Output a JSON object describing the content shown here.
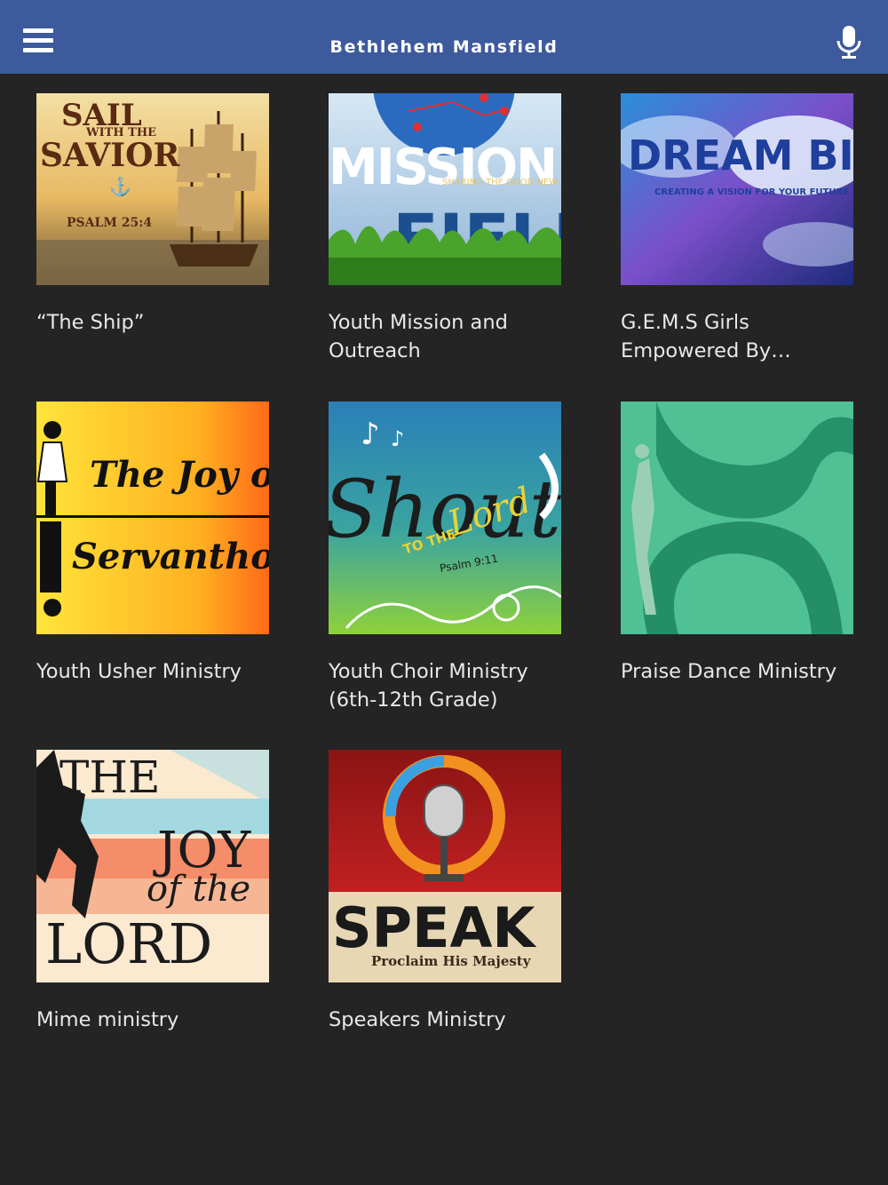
{
  "header": {
    "title": "Bethlehem Mansfield",
    "bg_color": "#3d5a9c",
    "menu_icon": "hamburger-menu-icon",
    "mic_icon": "microphone-icon"
  },
  "ministries": [
    {
      "label": "“The Ship”",
      "artwork": {
        "line1": "SAIL",
        "line2": "WITH THE",
        "line3": "SAVIOR",
        "line4": "PSALM 25:4"
      }
    },
    {
      "label": "Youth Mission and Outreach",
      "artwork": {
        "line1": "MISSION",
        "line2": "FIELD",
        "line3": "SHARING THE GOOD NEW"
      }
    },
    {
      "label": "G.E.M.S Girls Empowered By Ministry",
      "artwork": {
        "line1": "DREAM BIG",
        "line2": "CREATING A VISION FOR YOUR FUTURE"
      }
    },
    {
      "label": "Youth Usher Ministry",
      "artwork": {
        "line1": "The Joy of",
        "line2": "Servanthood"
      }
    },
    {
      "label": "Youth Choir Ministry (6th-12th Grade)",
      "artwork": {
        "line1": "Shout",
        "line2": "TO THE",
        "line3": "Lord",
        "line4": "Psalm 9:11"
      }
    },
    {
      "label": "Praise Dance Ministry",
      "artwork": {}
    },
    {
      "label": "Mime ministry",
      "artwork": {
        "line1": "THE",
        "line2": "JOY",
        "line3": "of the",
        "line4": "LORD"
      }
    },
    {
      "label": "Speakers Ministry",
      "artwork": {
        "line1": "SPEAK",
        "line2": "Proclaim His Majesty"
      }
    }
  ]
}
